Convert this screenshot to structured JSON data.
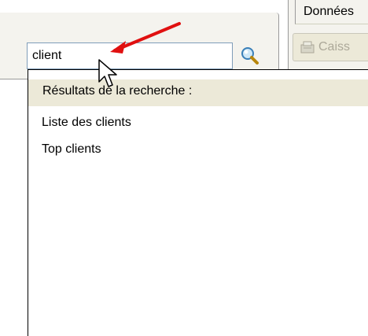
{
  "search": {
    "value": "client"
  },
  "right_panel": {
    "tab_label": "Données",
    "button_label": "Caiss"
  },
  "dropdown": {
    "header": "Résultats de la recherche :",
    "results": [
      "Liste des clients",
      "Top clients"
    ]
  },
  "colors": {
    "annotation_arrow": "#e01010",
    "panel_bg": "#f4f3ee",
    "header_bg": "#ece9d8",
    "input_border": "#7f9db9"
  },
  "icons": {
    "search": "magnifier-icon",
    "caisse": "cash-register-icon"
  }
}
